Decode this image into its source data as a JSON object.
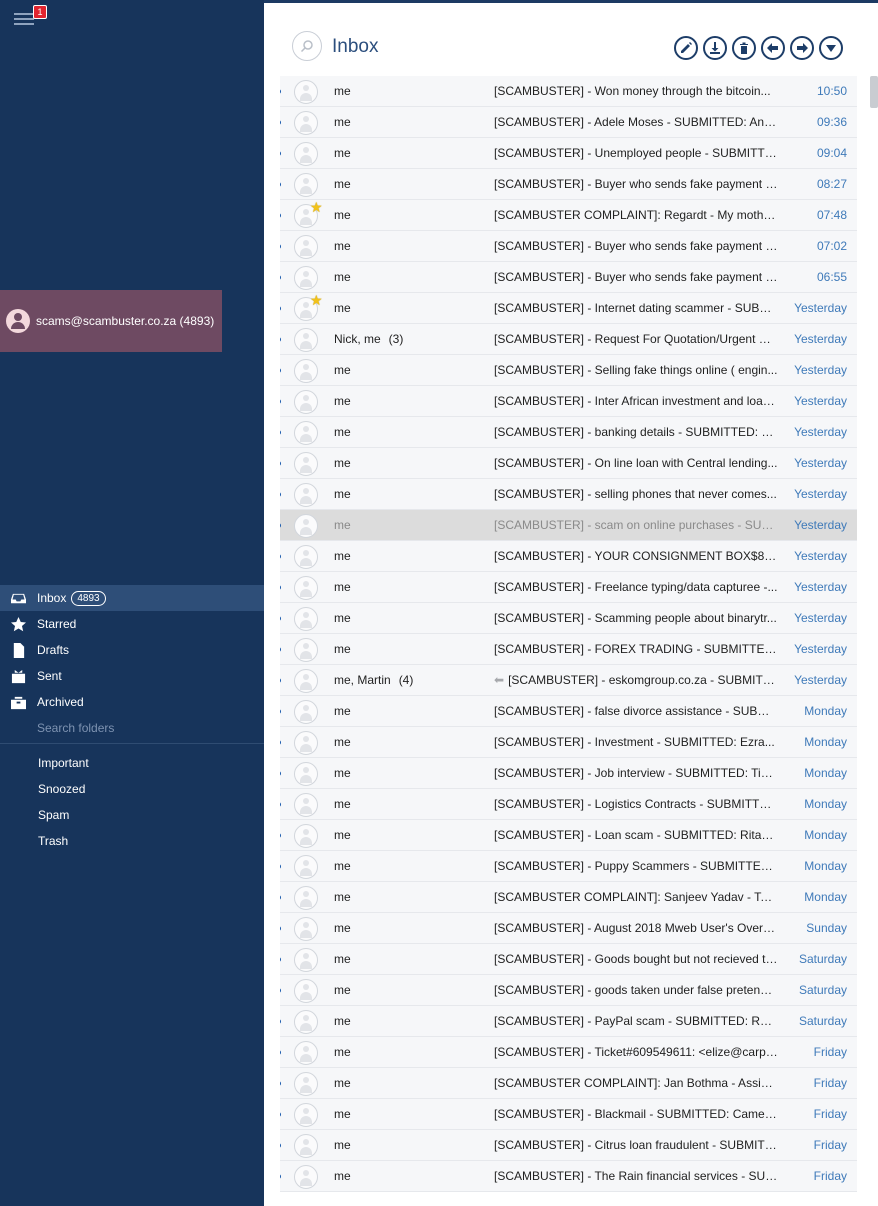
{
  "sidebar": {
    "notification_count": "1",
    "account": {
      "address": "scams@scambuster.co.za (4893)"
    },
    "folders": [
      {
        "label": "Inbox",
        "count": "4893",
        "icon": "inbox-icon"
      },
      {
        "label": "Starred",
        "icon": "star-icon"
      },
      {
        "label": "Drafts",
        "icon": "drafts-icon"
      },
      {
        "label": "Sent",
        "icon": "sent-icon"
      },
      {
        "label": "Archived",
        "icon": "archive-icon"
      }
    ],
    "search_folders": "Search folders",
    "more_folders": [
      "Important",
      "Snoozed",
      "Spam",
      "Trash"
    ]
  },
  "header": {
    "title": "Inbox",
    "toolbar": [
      "compose-icon",
      "download-icon",
      "delete-icon",
      "reply-icon",
      "forward-icon",
      "more-dropdown-icon"
    ]
  },
  "colors": {
    "sidebar": "#17345b",
    "account_bg": "#6e4a62",
    "accent": "#1a5aad",
    "time": "#3f7ab9",
    "star": "#f2c21a"
  },
  "messages": [
    {
      "sender": "me",
      "subject": "[SCAMBUSTER] - Won money through the bitcoin...",
      "time": "10:50"
    },
    {
      "sender": "me",
      "subject": "[SCAMBUSTER] - Adele Moses - SUBMITTED: Andr...",
      "time": "09:36"
    },
    {
      "sender": "me",
      "subject": "[SCAMBUSTER] - Unemployed people - SUBMITTE...",
      "time": "09:04"
    },
    {
      "sender": "me",
      "subject": "[SCAMBUSTER] - Buyer who sends fake payment n...",
      "time": "08:27"
    },
    {
      "sender": "me",
      "subject": "[SCAMBUSTER COMPLAINT]: Regardt - My mother...",
      "time": "07:48",
      "starred": true
    },
    {
      "sender": "me",
      "subject": "[SCAMBUSTER] - Buyer who sends fake payment n...",
      "time": "07:02"
    },
    {
      "sender": "me",
      "subject": "[SCAMBUSTER] - Buyer who sends fake payment n...",
      "time": "06:55"
    },
    {
      "sender": "me",
      "subject": "[SCAMBUSTER] - Internet dating scammer - SUBM...",
      "time": "Yesterday",
      "starred": true
    },
    {
      "sender": "Nick, me",
      "count": "(3)",
      "subject": "[SCAMBUSTER] - Request For Quotation/Urgent Su...",
      "time": "Yesterday"
    },
    {
      "sender": "me",
      "subject": "[SCAMBUSTER] - Selling fake things online ( engin...",
      "time": "Yesterday"
    },
    {
      "sender": "me",
      "subject": "[SCAMBUSTER] - Inter African investment and loan...",
      "time": "Yesterday"
    },
    {
      "sender": "me",
      "subject": "[SCAMBUSTER] - banking details - SUBMITTED: Br...",
      "time": "Yesterday"
    },
    {
      "sender": "me",
      "subject": "[SCAMBUSTER] - On line loan with Central lending...",
      "time": "Yesterday"
    },
    {
      "sender": "me",
      "subject": "[SCAMBUSTER] - selling phones that never comes...",
      "time": "Yesterday"
    },
    {
      "sender": "me",
      "subject": "[SCAMBUSTER] - scam on online purchases - SUB...",
      "time": "Yesterday",
      "selected": true
    },
    {
      "sender": "me",
      "subject": "[SCAMBUSTER] - YOUR CONSIGNMENT BOX$8,00...",
      "time": "Yesterday"
    },
    {
      "sender": "me",
      "subject": "[SCAMBUSTER] - Freelance typing/data capturee -...",
      "time": "Yesterday"
    },
    {
      "sender": "me",
      "subject": "[SCAMBUSTER] - Scamming people about binarytr...",
      "time": "Yesterday"
    },
    {
      "sender": "me",
      "subject": "[SCAMBUSTER] - FOREX TRADING - SUBMITTED: J...",
      "time": "Yesterday"
    },
    {
      "sender": "me, Martin",
      "count": "(4)",
      "subject": "[SCAMBUSTER] - eskomgroup.co.za - SUBMITT...",
      "time": "Yesterday",
      "replied": true
    },
    {
      "sender": "me",
      "subject": "[SCAMBUSTER] - false divorce assistance - SUBMIT...",
      "time": "Monday"
    },
    {
      "sender": "me",
      "subject": "[SCAMBUSTER] - Investment - SUBMITTED: Ezra...",
      "time": "Monday"
    },
    {
      "sender": "me",
      "subject": "[SCAMBUSTER] - Job interview - SUBMITTED: Tiel...",
      "time": "Monday"
    },
    {
      "sender": "me",
      "subject": "[SCAMBUSTER] - Logistics Contracts - SUBMITTED...",
      "time": "Monday"
    },
    {
      "sender": "me",
      "subject": "[SCAMBUSTER] - Loan scam - SUBMITTED: Ritasha...",
      "time": "Monday"
    },
    {
      "sender": "me",
      "subject": "[SCAMBUSTER] - Puppy Scammers - SUBMITTED:...",
      "time": "Monday"
    },
    {
      "sender": "me",
      "subject": "[SCAMBUSTER COMPLAINT]: Sanjeev Yadav - Top...",
      "time": "Monday"
    },
    {
      "sender": "me",
      "subject": "[SCAMBUSTER] - August 2018 Mweb User's Overdr...",
      "time": "Sunday"
    },
    {
      "sender": "me",
      "subject": "[SCAMBUSTER] - Goods bought but not recieved tr...",
      "time": "Saturday"
    },
    {
      "sender": "me",
      "subject": "[SCAMBUSTER] - goods taken under false pretense...",
      "time": "Saturday"
    },
    {
      "sender": "me",
      "subject": "[SCAMBUSTER] - PayPal scam - SUBMITTED: ROBE...",
      "time": "Saturday"
    },
    {
      "sender": "me",
      "subject": "[SCAMBUSTER] - Ticket#609549611: <elize@carpe...",
      "time": "Friday"
    },
    {
      "sender": "me",
      "subject": "[SCAMBUSTER COMPLAINT]: Jan Bothma - Assista...",
      "time": "Friday"
    },
    {
      "sender": "me",
      "subject": "[SCAMBUSTER] - Blackmail - SUBMITTED: Camero...",
      "time": "Friday"
    },
    {
      "sender": "me",
      "subject": "[SCAMBUSTER] - Citrus loan fraudulent - SUBMITT...",
      "time": "Friday"
    },
    {
      "sender": "me",
      "subject": "[SCAMBUSTER] - The Rain financial services - SUB...",
      "time": "Friday"
    }
  ]
}
